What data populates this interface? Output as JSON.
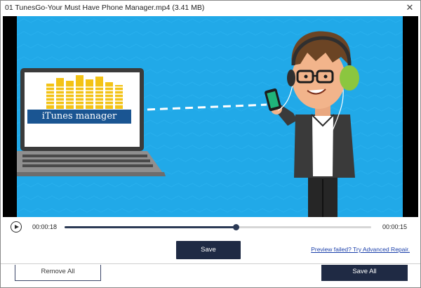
{
  "window": {
    "title": "01 TunesGo-Your Must Have Phone Manager.mp4 (3.41  MB)",
    "close_glyph": "✕"
  },
  "video": {
    "overlay_text": "iTunes manager",
    "colors": {
      "background": "#21a9e8",
      "label_bg": "#1a5592"
    }
  },
  "player": {
    "current_time": "00:00:18",
    "end_time": "00:00:15",
    "progress": 0.56
  },
  "actions": {
    "save_label": "Save",
    "preview_link": "Preview failed? Try Advanced Repair.",
    "remove_all_label": "Remove All",
    "save_all_label": "Save All"
  },
  "icons": {
    "close": "close-icon",
    "play": "play-icon"
  },
  "colors": {
    "accent": "#1f2a44",
    "link": "#1a3faa"
  }
}
